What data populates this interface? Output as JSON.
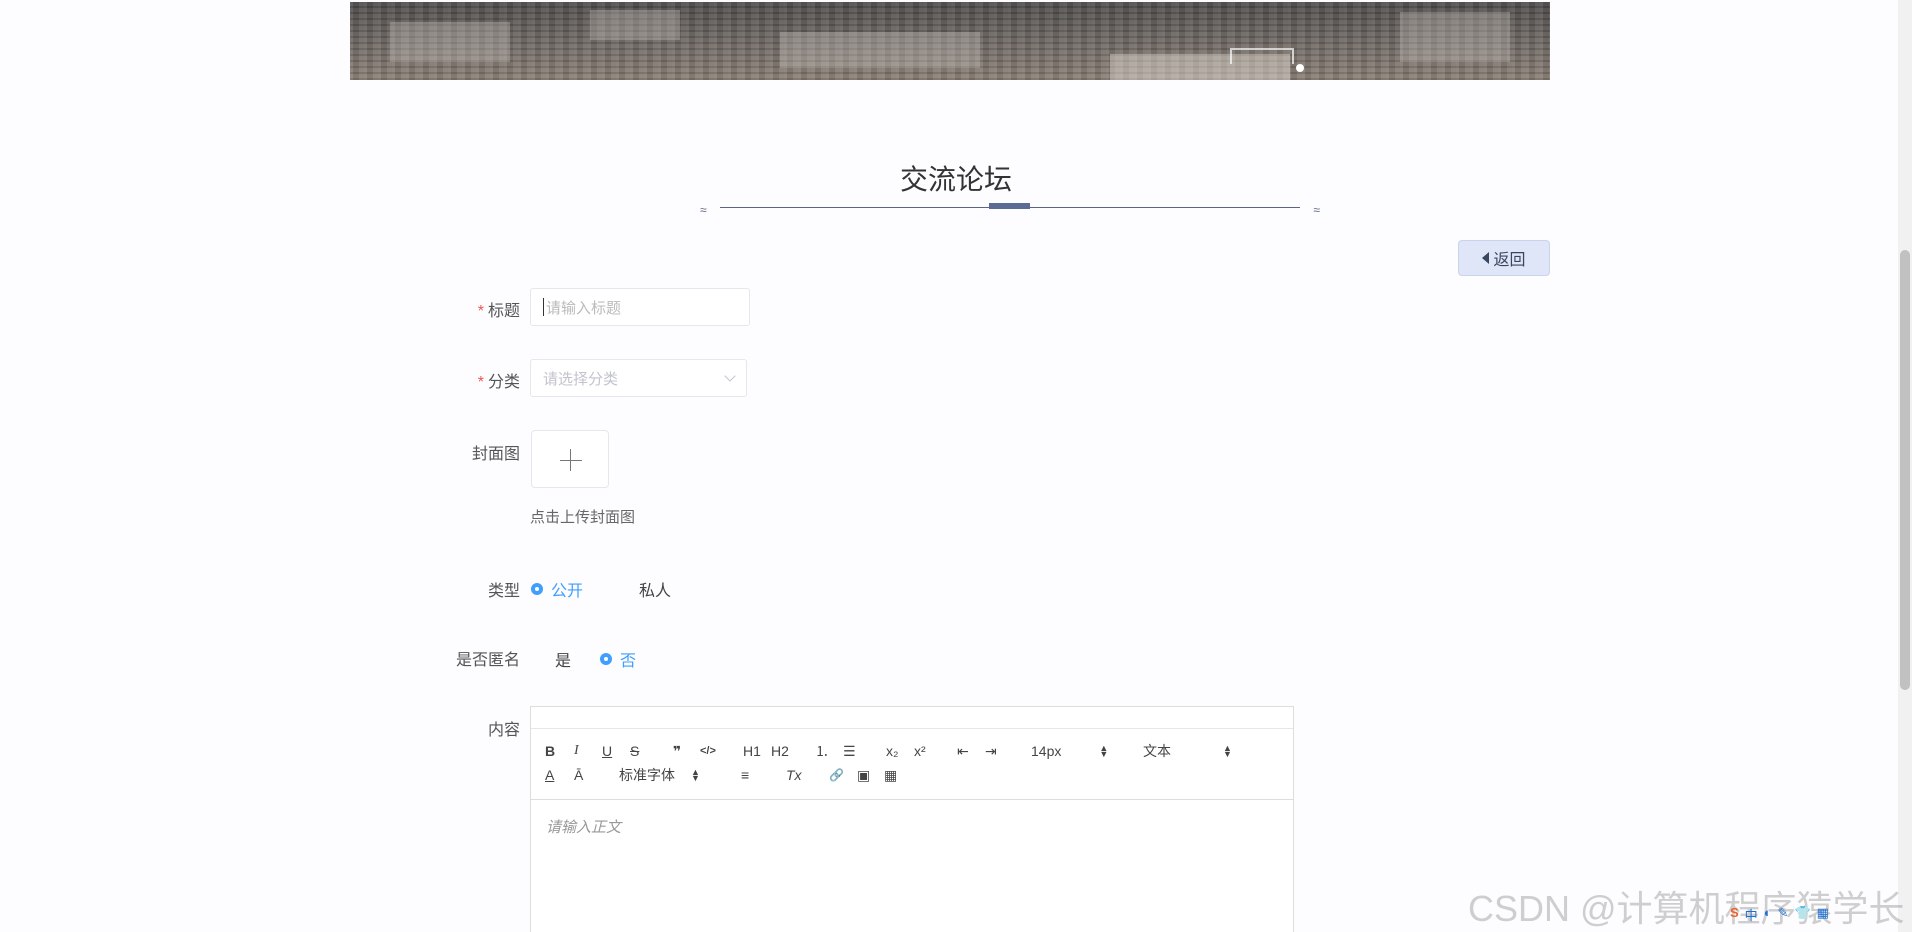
{
  "page": {
    "title": "交流论坛",
    "back_label": "返回"
  },
  "form": {
    "title_label": "标题",
    "title_placeholder": "请输入标题",
    "category_label": "分类",
    "category_placeholder": "请选择分类",
    "cover_label": "封面图",
    "cover_tip": "点击上传封面图",
    "type_label": "类型",
    "type_options": [
      "公开",
      "私人"
    ],
    "type_selected": "公开",
    "anon_label": "是否匿名",
    "anon_options": [
      "是",
      "否"
    ],
    "anon_selected": "否",
    "content_label": "内容",
    "required_mark": "*"
  },
  "editor": {
    "buttons": {
      "bold": "B",
      "italic": "I",
      "underline": "U",
      "strike": "S",
      "quote": "❞",
      "code": "</>",
      "h1": "H1",
      "h2": "H2",
      "ordered_list": "⒈",
      "bullet_list": "☰",
      "subscript": "x₂",
      "superscript": "x²",
      "outdent": "⇤",
      "indent": "⇥",
      "font_color": "A",
      "background": "Ā",
      "align": "≡",
      "clean": "Tx",
      "link": "🔗",
      "image": "▣",
      "video": "▦"
    },
    "size_value": "14px",
    "header_value": "文本",
    "font_value": "标准字体",
    "body_placeholder": "请输入正文"
  },
  "watermark": "CSDN @计算机程序猿学长",
  "tray": [
    "S",
    "中",
    "◐",
    "✎",
    "👕",
    "▦"
  ],
  "colors": {
    "accent": "#409eff",
    "title_bar": "#5c6b93",
    "back_bg": "#dfe6f7"
  }
}
